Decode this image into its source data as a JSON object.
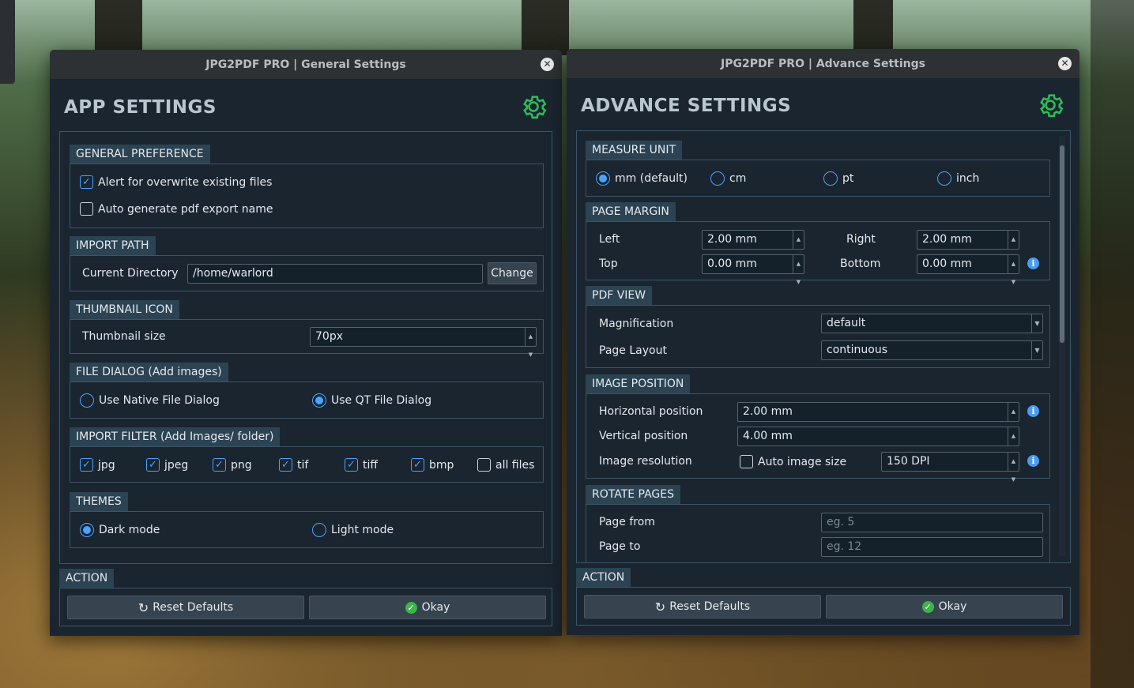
{
  "general_window": {
    "title": "JPG2PDF PRO | General Settings",
    "heading": "APP SETTINGS",
    "general_preference": {
      "label": "GENERAL PREFERENCE",
      "alert_overwrite": "Alert for overwrite existing files",
      "alert_overwrite_checked": true,
      "auto_generate": "Auto generate pdf export name",
      "auto_generate_checked": false
    },
    "import_path": {
      "label": "IMPORT PATH",
      "current_dir_label": "Current Directory",
      "current_dir_value": "/home/warlord",
      "change_button": "Change"
    },
    "thumbnail_icon": {
      "label": "THUMBNAIL ICON",
      "size_label": "Thumbnail size",
      "size_value": "70px"
    },
    "file_dialog": {
      "label": "FILE DIALOG (Add images)",
      "native": "Use Native File Dialog",
      "qt": "Use QT File Dialog",
      "selected": "qt"
    },
    "import_filter": {
      "label": "IMPORT FILTER (Add Images/ folder)",
      "items": [
        {
          "label": "jpg",
          "checked": true
        },
        {
          "label": "jpeg",
          "checked": true
        },
        {
          "label": "png",
          "checked": true
        },
        {
          "label": "tif",
          "checked": true
        },
        {
          "label": "tiff",
          "checked": true
        },
        {
          "label": "bmp",
          "checked": true
        },
        {
          "label": "all files",
          "checked": false
        }
      ]
    },
    "themes": {
      "label": "THEMES",
      "dark": "Dark mode",
      "light": "Light mode",
      "selected": "dark"
    },
    "action": {
      "label": "ACTION",
      "reset": "Reset Defaults",
      "okay": "Okay"
    }
  },
  "advance_window": {
    "title": "JPG2PDF PRO | Advance Settings",
    "heading": "ADVANCE SETTINGS",
    "measure_unit": {
      "label": "MEASURE UNIT",
      "options": [
        "mm (default)",
        "cm",
        "pt",
        "inch"
      ],
      "selected": "mm (default)"
    },
    "page_margin": {
      "label": "PAGE MARGIN",
      "left_label": "Left",
      "left_value": "2.00 mm",
      "right_label": "Right",
      "right_value": "2.00 mm",
      "top_label": "Top",
      "top_value": "0.00 mm",
      "bottom_label": "Bottom",
      "bottom_value": "0.00 mm"
    },
    "pdf_view": {
      "label": "PDF VIEW",
      "magnification_label": "Magnification",
      "magnification_value": "default",
      "layout_label": "Page Layout",
      "layout_value": "continuous"
    },
    "image_position": {
      "label": "IMAGE POSITION",
      "horizontal_label": "Horizontal position",
      "horizontal_value": "2.00 mm",
      "vertical_label": "Vertical position",
      "vertical_value": "4.00 mm",
      "resolution_label": "Image resolution",
      "auto_size_label": "Auto image size",
      "auto_size_checked": false,
      "resolution_value": "150 DPI"
    },
    "rotate_pages": {
      "label": "ROTATE PAGES",
      "from_label": "Page from",
      "from_placeholder": "eg. 5",
      "to_label": "Page to",
      "to_placeholder": "eg. 12"
    },
    "action": {
      "label": "ACTION",
      "reset": "Reset Defaults",
      "okay": "Okay"
    }
  },
  "colors": {
    "accent": "#4aa3ff",
    "gear_green": "#2ebd5a",
    "ok_green": "#3cb44a",
    "window_bg": "#1a2530",
    "group_label_bg": "#2b4353"
  }
}
